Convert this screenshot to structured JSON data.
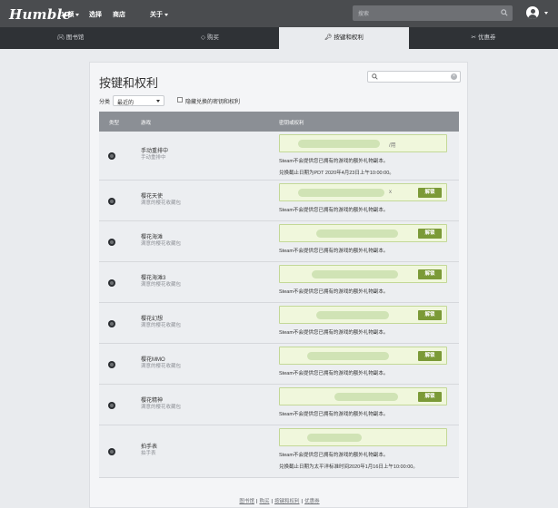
{
  "header": {
    "logo": "Humble",
    "nav": [
      {
        "label": "11额",
        "has_caret": true
      },
      {
        "label": "选择",
        "has_caret": false
      },
      {
        "label": "商店",
        "has_caret": false
      },
      {
        "label": "关于",
        "has_caret": true
      }
    ],
    "search_placeholder": "搜索"
  },
  "tabs": [
    {
      "icon": "gamepad",
      "label": "图书馆",
      "active": false
    },
    {
      "icon": "tag",
      "label": "购买",
      "active": false
    },
    {
      "icon": "key",
      "label": "按键和权利",
      "active": true
    },
    {
      "icon": "ticket",
      "label": "优惠券",
      "active": false
    }
  ],
  "page": {
    "title": "按键和权利",
    "filter_label": "分类",
    "sort_value": "最近的",
    "hide_redeemed_label": "隐藏兑换的密钥和权利"
  },
  "table": {
    "headers": [
      "类型",
      "游戏",
      "密钥或权利"
    ],
    "rows": [
      {
        "name": "手动重排中",
        "sub": "手动重排中",
        "key_tail": "/用",
        "has_button": false,
        "note": "Steam不会提供您已拥有的游戏的额外礼物副本。",
        "expire": "兑换截止日期为PDT 2020年4月23日上午10:00:00。"
      },
      {
        "name": "樱花天使",
        "sub": "满意的樱花收藏包",
        "key_tail": "x",
        "has_button": true,
        "note": "Steam不会提供您已拥有的游戏的额外礼物副本。",
        "expire": ""
      },
      {
        "name": "樱花海滩",
        "sub": "满意的樱花收藏包",
        "key_tail": "",
        "has_button": true,
        "note": "Steam不会提供您已拥有的游戏的额外礼物副本。",
        "expire": ""
      },
      {
        "name": "樱花海滩3",
        "sub": "满意的樱花收藏包",
        "key_tail": "",
        "has_button": true,
        "note": "Steam不会提供您已拥有的游戏的额外礼物副本。",
        "expire": ""
      },
      {
        "name": "樱花幻想",
        "sub": "满意的樱花收藏包",
        "key_tail": "",
        "has_button": true,
        "note": "Steam不会提供您已拥有的游戏的额外礼物副本。",
        "expire": ""
      },
      {
        "name": "樱花MMO",
        "sub": "满意的樱花收藏包",
        "key_tail": "",
        "has_button": true,
        "note": "Steam不会提供您已拥有的游戏的额外礼物副本。",
        "expire": ""
      },
      {
        "name": "樱花精神",
        "sub": "满意的樱花收藏包",
        "key_tail": "",
        "has_button": true,
        "note": "Steam不会提供您已拥有的游戏的额外礼物副本。",
        "expire": ""
      },
      {
        "name": "拍手表",
        "sub": "拍手表",
        "key_tail": "",
        "has_button": false,
        "note": "Steam不会提供您已拥有的游戏的额外礼物副本。",
        "expire": "兑换截止日期为太平洋标准时间2020年1月16日上午10:00:00。"
      }
    ],
    "redeem_label": "解锁"
  },
  "footer": {
    "links": [
      "图书馆",
      "购买",
      "按键和权利",
      "优惠券"
    ],
    "separator": "|"
  },
  "colors": {
    "header_bg": "#4a4c4f",
    "tabbar_bg": "#2f3236",
    "redeem_green": "#7b9a37",
    "key_bg": "#f0f7dc"
  }
}
